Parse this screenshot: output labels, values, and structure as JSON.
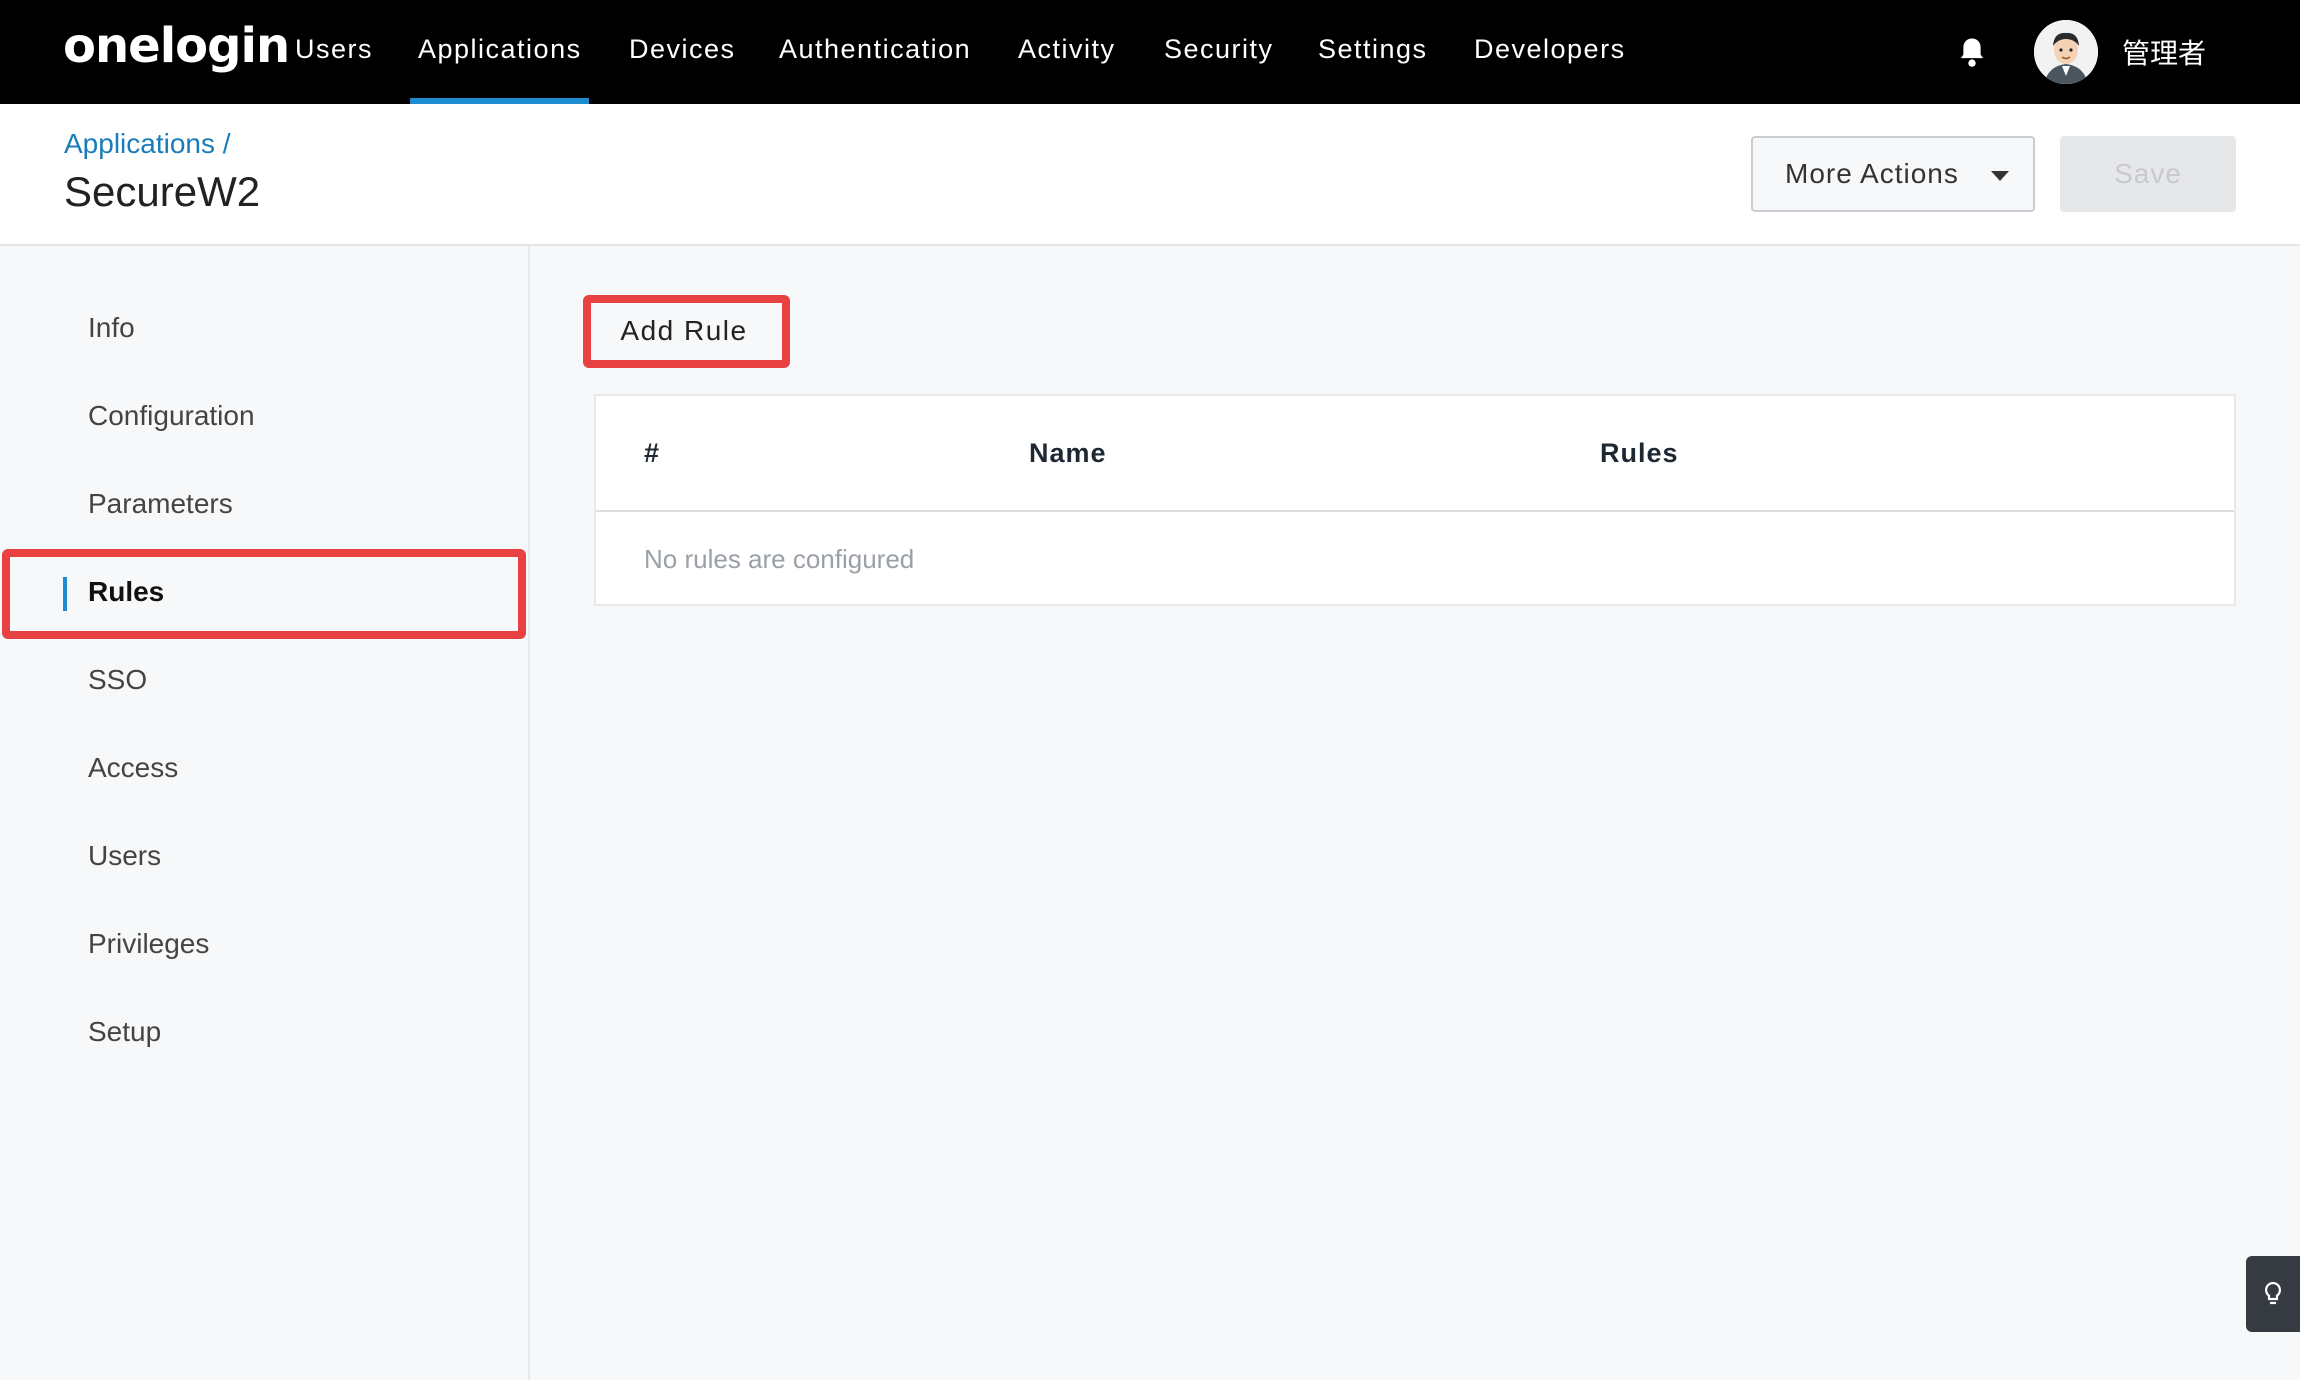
{
  "app": {
    "logo": "onelogin"
  },
  "nav": {
    "items": [
      {
        "label": "Users"
      },
      {
        "label": "Applications"
      },
      {
        "label": "Devices"
      },
      {
        "label": "Authentication"
      },
      {
        "label": "Activity"
      },
      {
        "label": "Security"
      },
      {
        "label": "Settings"
      },
      {
        "label": "Developers"
      }
    ],
    "active": "Applications",
    "user_name": "管理者"
  },
  "header": {
    "breadcrumb": "Applications /",
    "title": "SecureW2",
    "more_actions_label": "More Actions",
    "save_label": "Save"
  },
  "sidebar": {
    "items": [
      {
        "label": "Info"
      },
      {
        "label": "Configuration"
      },
      {
        "label": "Parameters"
      },
      {
        "label": "Rules"
      },
      {
        "label": "SSO"
      },
      {
        "label": "Access"
      },
      {
        "label": "Users"
      },
      {
        "label": "Privileges"
      },
      {
        "label": "Setup"
      }
    ],
    "active": "Rules"
  },
  "main": {
    "add_rule_label": "Add Rule",
    "table": {
      "columns": [
        "#",
        "Name",
        "Rules"
      ],
      "empty_message": "No rules are configured"
    }
  },
  "colors": {
    "accent": "#1f8ccf",
    "highlight": "#e84141",
    "nav_bg": "#000000"
  },
  "icons": {
    "bell": "bell-icon",
    "avatar": "avatar",
    "caret": "chevron-down-icon",
    "help": "lightbulb-icon"
  }
}
